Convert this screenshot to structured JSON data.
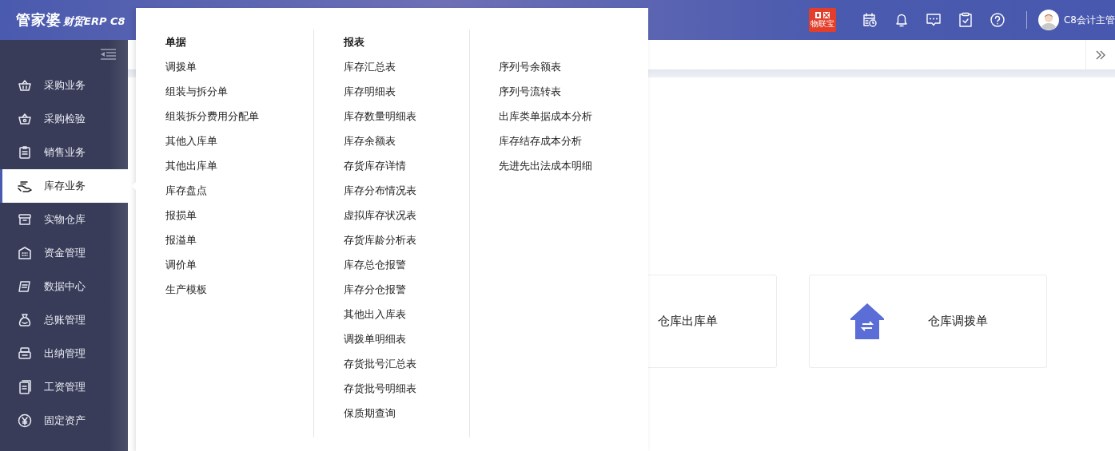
{
  "header": {
    "brand": "管家婆",
    "product": "财贸ERP C8",
    "badge": "物联宝",
    "user": "C8会计主管"
  },
  "sidebar": {
    "items": [
      {
        "label": "采购业务",
        "selected": false
      },
      {
        "label": "采购检验",
        "selected": false
      },
      {
        "label": "销售业务",
        "selected": false
      },
      {
        "label": "库存业务",
        "selected": true
      },
      {
        "label": "实物仓库",
        "selected": false
      },
      {
        "label": "资金管理",
        "selected": false
      },
      {
        "label": "数据中心",
        "selected": false
      },
      {
        "label": "总账管理",
        "selected": false
      },
      {
        "label": "出纳管理",
        "selected": false
      },
      {
        "label": "工资管理",
        "selected": false
      },
      {
        "label": "固定资产",
        "selected": false
      }
    ]
  },
  "cards": [
    {
      "label": "仓库出库单"
    },
    {
      "label": "仓库调拨单"
    }
  ],
  "menu": {
    "columns": [
      {
        "heading": "单据",
        "items": [
          "调拨单",
          "组装与拆分单",
          "组装拆分费用分配单",
          "其他入库单",
          "其他出库单",
          "库存盘点",
          "报损单",
          "报溢单",
          "调价单",
          "生产模板"
        ]
      },
      {
        "heading": "报表",
        "items": [
          "库存汇总表",
          "库存明细表",
          "库存数量明细表",
          "库存余额表",
          "存货库存详情",
          "库存分布情况表",
          "虚拟库存状况表",
          "存货库龄分析表",
          "库存总仓报警",
          "库存分仓报警",
          "其他出入库表",
          "调拨单明细表",
          "存货批号汇总表",
          "存货批号明细表",
          "保质期查询"
        ]
      },
      {
        "items": [
          "序列号余额表",
          "序列号流转表",
          "出库类单据成本分析",
          "库存结存成本分析",
          "先进先出法成本明细"
        ]
      }
    ]
  }
}
